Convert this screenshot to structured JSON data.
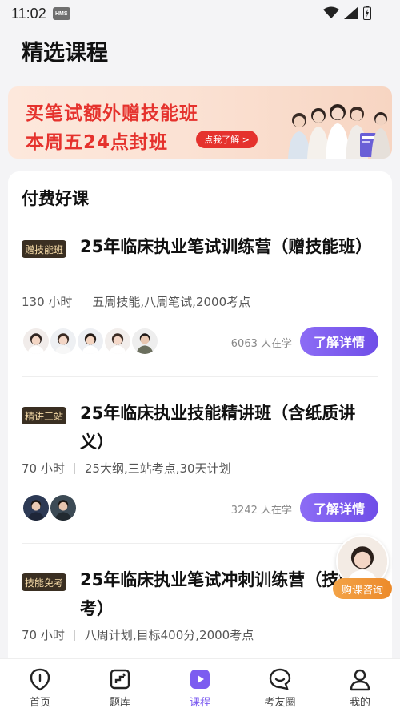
{
  "status_bar": {
    "time": "11:02",
    "badge": "HMS"
  },
  "page": {
    "title": "精选课程"
  },
  "banner": {
    "line1": "买笔试额外赠技能班",
    "line2": "本周五24点封班",
    "cta": "点我了解 >"
  },
  "section": {
    "title": "付费好课"
  },
  "courses": [
    {
      "tag": "赠技能班",
      "title": "25年临床执业笔试训练营（赠技能班）",
      "hours": "130 小时",
      "desc": "五周技能,八周笔试,2000考点",
      "learners": "6063 人在学",
      "button": "了解详情"
    },
    {
      "tag": "精讲三站",
      "title": "25年临床执业技能精讲班（含纸质讲义）",
      "hours": "70 小时",
      "desc": "25大纲,三站考点,30天计划",
      "learners": "3242 人在学",
      "button": "了解详情"
    },
    {
      "tag": "技能免考",
      "title": "25年临床执业笔试冲刺训练营（技能免考）",
      "hours": "70 小时",
      "desc": "八周计划,目标400分,2000考点"
    }
  ],
  "consult": {
    "label": "购课咨询"
  },
  "tabbar": {
    "items": [
      {
        "label": "首页",
        "icon": "home-icon"
      },
      {
        "label": "题库",
        "icon": "question-bank-icon"
      },
      {
        "label": "课程",
        "icon": "course-play-icon",
        "active": true
      },
      {
        "label": "考友圈",
        "icon": "chat-bubble-icon"
      },
      {
        "label": "我的",
        "icon": "profile-icon"
      }
    ]
  },
  "colors": {
    "accent": "#7c5cf0",
    "banner_red": "#e5322d",
    "consult_orange": "#ec8a2a",
    "tag_bg": "#3a2f22",
    "tag_text": "#f4d9a6"
  }
}
